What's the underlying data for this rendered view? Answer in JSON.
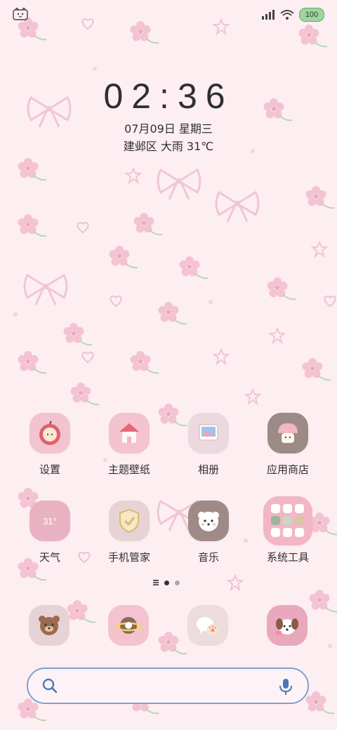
{
  "status_bar": {
    "battery_level": "100",
    "left_icon": "cat-emoji-icon",
    "right_icons": [
      "signal-icon",
      "wifi-icon",
      "battery-icon"
    ]
  },
  "lock": {
    "time": "02:36",
    "date": "07月09日 星期三",
    "weather": "建邺区 大雨 31℃"
  },
  "apps": [
    {
      "label": "设置",
      "icon": "apple-settings-icon"
    },
    {
      "label": "主题壁纸",
      "icon": "house-theme-icon"
    },
    {
      "label": "相册",
      "icon": "photo-gallery-icon"
    },
    {
      "label": "应用商店",
      "icon": "mushroom-store-icon"
    },
    {
      "label": "天气",
      "icon": "weather-icon",
      "icon_text": "31°"
    },
    {
      "label": "手机管家",
      "icon": "shield-check-icon"
    },
    {
      "label": "音乐",
      "icon": "puppy-music-icon"
    },
    {
      "label": "系统工具",
      "icon": "tools-folder-icon"
    }
  ],
  "dock": [
    {
      "icon": "bear-phone-icon"
    },
    {
      "icon": "planet-browser-icon"
    },
    {
      "icon": "chat-paw-icon"
    },
    {
      "icon": "dog-camera-icon"
    }
  ],
  "page_indicator": {
    "total": 2,
    "active": 0
  },
  "colors": {
    "background": "#fdeef2",
    "search_border": "#7f9fd0",
    "battery": "#9fd49f",
    "text": "#2f2f2f"
  }
}
